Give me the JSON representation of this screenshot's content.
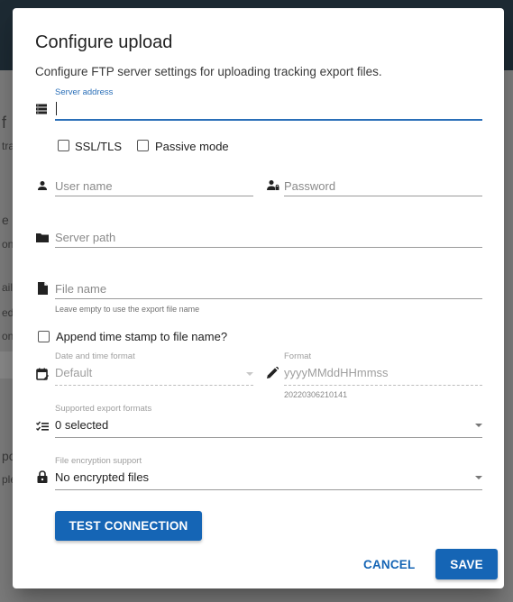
{
  "background": {
    "fragments": [
      "f",
      "tra",
      "e",
      "on",
      "ail",
      "ed",
      "on",
      "po",
      "ple"
    ]
  },
  "dialog": {
    "title": "Configure upload",
    "subtitle": "Configure FTP server settings for uploading tracking export files.",
    "server_address": {
      "label": "Server address",
      "value": "",
      "icon": "server-icon"
    },
    "ssl_tls": {
      "label": "SSL/TLS",
      "checked": false
    },
    "passive_mode": {
      "label": "Passive mode",
      "checked": false
    },
    "user_name": {
      "placeholder": "User name",
      "value": "",
      "icon": "person-icon"
    },
    "password": {
      "placeholder": "Password",
      "value": "",
      "icon": "person-key-icon"
    },
    "server_path": {
      "placeholder": "Server path",
      "value": "",
      "icon": "folder-icon"
    },
    "file_name": {
      "placeholder": "File name",
      "value": "",
      "hint": "Leave empty to use the export file name",
      "icon": "file-icon"
    },
    "append_timestamp": {
      "label": "Append time stamp to file name?",
      "checked": false
    },
    "date_time_format": {
      "label": "Date and time format",
      "value": "Default",
      "icon": "calendar-edit-icon",
      "disabled": true
    },
    "format": {
      "label": "Format",
      "value": "yyyyMMddHHmmss",
      "preview": "20220306210141",
      "icon": "pencil-icon",
      "disabled": true
    },
    "export_formats": {
      "label": "Supported export formats",
      "value": "0 selected",
      "icon": "list-check-icon"
    },
    "encryption": {
      "label": "File encryption support",
      "value": "No encrypted files",
      "icon": "lock-icon"
    },
    "test_connection_label": "TEST CONNECTION",
    "cancel_label": "CANCEL",
    "save_label": "SAVE",
    "colors": {
      "primary": "#1565b5",
      "focus": "#2a6fb8"
    }
  }
}
